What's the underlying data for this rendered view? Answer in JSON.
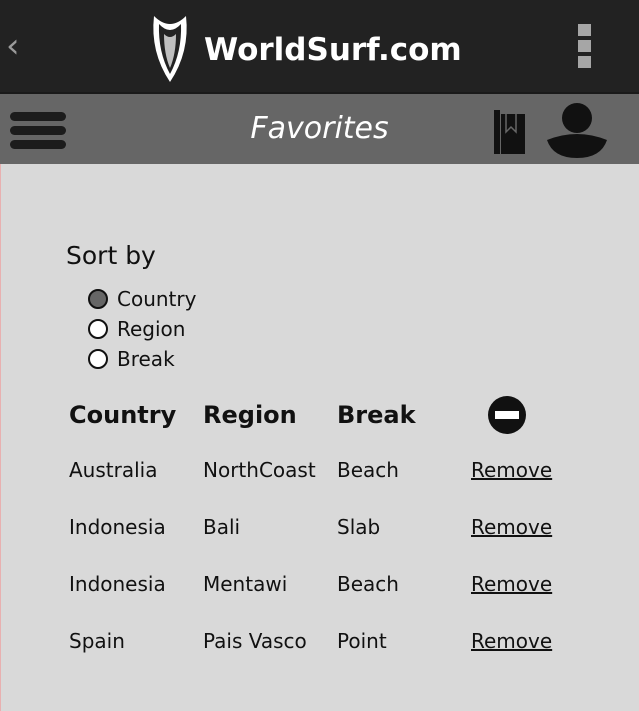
{
  "header": {
    "app_title": "WorldSurf.com",
    "back_icon": "chevron-left-icon",
    "menu_icon": "kebab-menu-icon"
  },
  "subheader": {
    "title": "Favorites",
    "menu_icon": "hamburger-icon",
    "bookmark_icon": "bookmark-icon",
    "profile_icon": "user-icon"
  },
  "sort": {
    "label": "Sort by",
    "options": [
      {
        "label": "Country",
        "selected": true
      },
      {
        "label": "Region",
        "selected": false
      },
      {
        "label": "Break",
        "selected": false
      }
    ]
  },
  "table": {
    "headers": [
      "Country",
      "Region",
      "Break"
    ],
    "remove_header_icon": "minus-circle-icon",
    "rows": [
      {
        "country": "Australia",
        "region": "NorthCoast",
        "break": "Beach",
        "action": "Remove "
      },
      {
        "country": "Indonesia",
        "region": "Bali",
        "break": "Slab",
        "action": "Remove"
      },
      {
        "country": "Indonesia",
        "region": "Mentawi",
        "break": "Beach",
        "action": "Remove"
      },
      {
        "country": "Spain",
        "region": "Pais Vasco",
        "break": "Point",
        "action": "Remove"
      }
    ]
  },
  "colors": {
    "topbar": "#222222",
    "subbar": "#666666",
    "background": "#d9d9d9"
  }
}
